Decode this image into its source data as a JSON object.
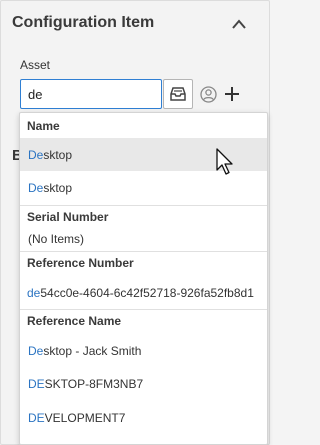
{
  "panel": {
    "title": "Configuration Item",
    "asset_label": "Asset",
    "asset_value": "de",
    "background_label_fragment": "B"
  },
  "icons": {
    "collapse": "chevron-up-icon",
    "lookup": "inbox-icon",
    "person": "user-circle-icon",
    "add": "plus-icon"
  },
  "dropdown": {
    "name_header": "Name",
    "name_items": [
      {
        "match": "De",
        "rest": "sktop"
      },
      {
        "match": "De",
        "rest": "sktop"
      }
    ],
    "serial_header": "Serial Number",
    "serial_empty": "(No Items)",
    "reference_number_header": "Reference Number",
    "reference_number_items": [
      {
        "match": "de",
        "rest": "54cc0e-4604-6c42f52718-926fa52fb8d1"
      }
    ],
    "reference_name_header": "Reference Name",
    "reference_name_items": [
      {
        "match": "De",
        "rest": "sktop - Jack Smith"
      },
      {
        "match": "DE",
        "rest": "SKTOP-8FM3NB7"
      },
      {
        "match": "DE",
        "rest": "VELOPMENT7"
      }
    ]
  },
  "colors": {
    "highlight": "#2b74c2",
    "input_border": "#2f7fd3",
    "hover_row": "#e8e8e8"
  }
}
